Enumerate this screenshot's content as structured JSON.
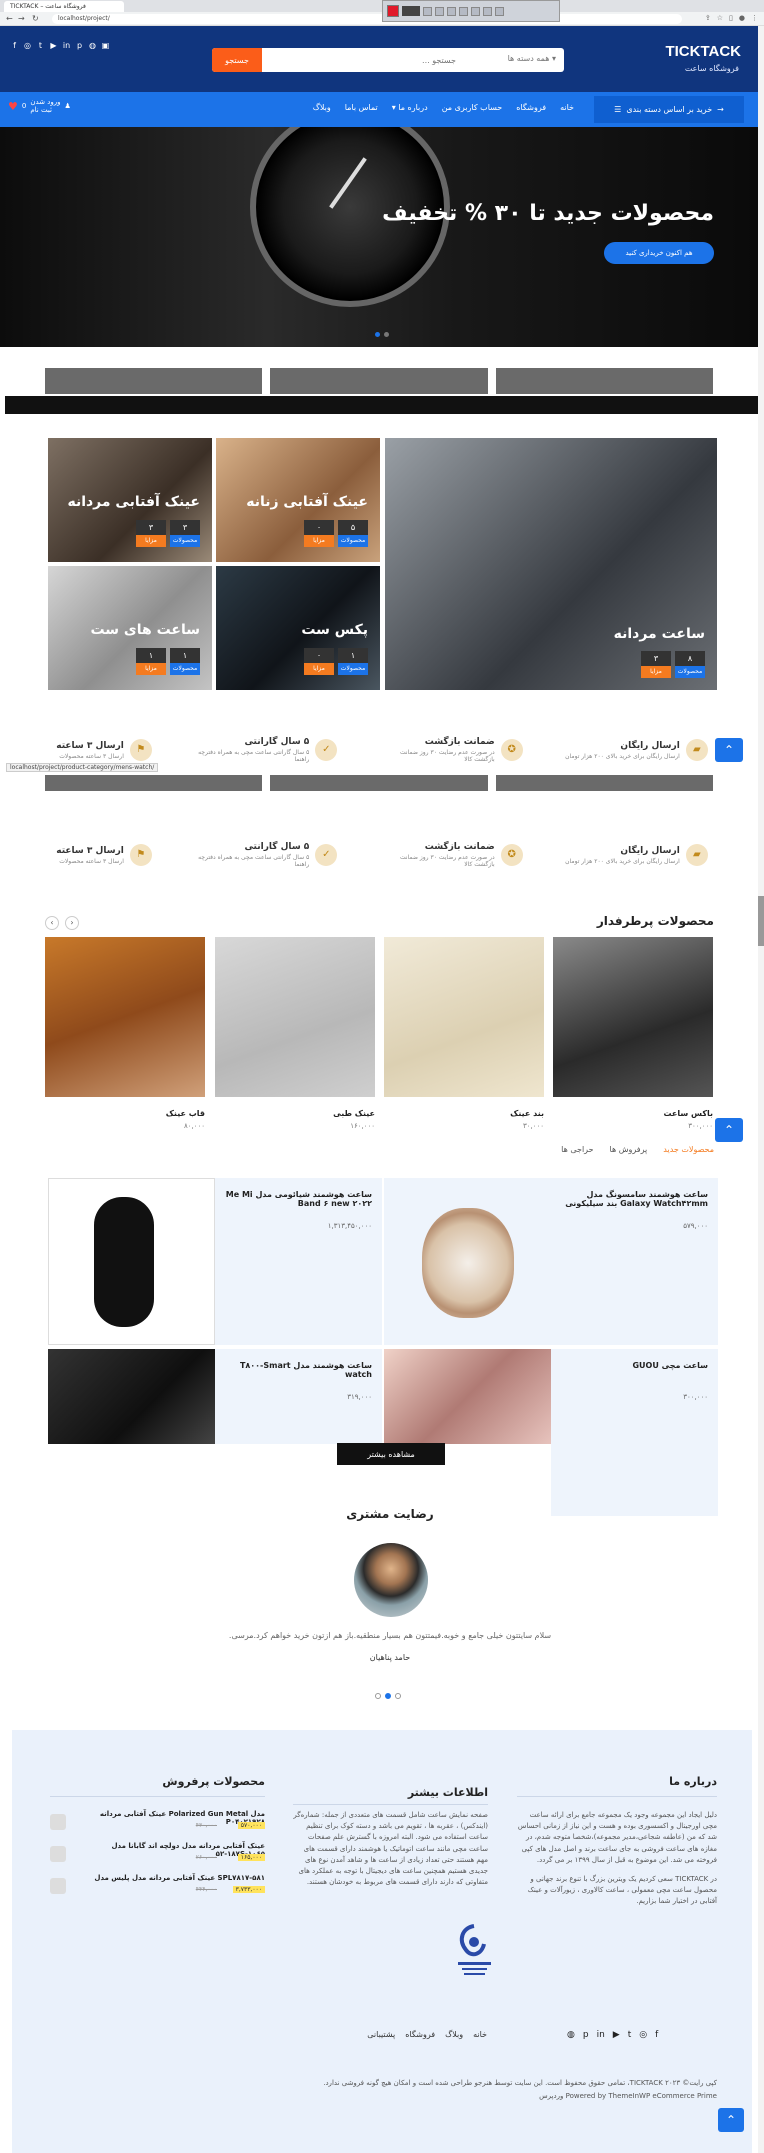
{
  "browser": {
    "tab_title": "TICKTACK – فروشگاه ساعت",
    "address": "localhost/project/"
  },
  "header": {
    "logo_title": "TICKTACK",
    "logo_subtitle": "فروشگاه ساعت",
    "search_button": "جستجو",
    "search_placeholder": "جستجو ...",
    "search_category": "همه دسته ها"
  },
  "nav": {
    "category_button": "خرید بر اساس دسته بندی",
    "links": [
      "خانه",
      "فروشگاه",
      "حساب کاربری من",
      "درباره ما",
      "تماس باما",
      "وبلاگ"
    ],
    "login": "ورود | ثبت نام",
    "login_line1": "ورود شدن",
    "login_line2": "ثبت نام",
    "cart_count": "0"
  },
  "hero": {
    "title": "محصولات جدید تا ۳۰ % تخفیف",
    "button": "هم اکنون خریداری کنید"
  },
  "categories": [
    {
      "label": "ساعت مردانه",
      "badges": [
        {
          "n": "۸",
          "t": "محصولات"
        },
        {
          "n": "۳",
          "t": "مزایا"
        }
      ]
    },
    {
      "label": "عینک آفتابی زنانه",
      "badges": [
        {
          "n": "۵",
          "t": "محصولات"
        },
        {
          "n": "۰",
          "t": "مزایا"
        }
      ]
    },
    {
      "label": "عینک آفتابی مردانه",
      "badges": [
        {
          "n": "۳",
          "t": "محصولات"
        },
        {
          "n": "۳",
          "t": "مزایا"
        }
      ]
    },
    {
      "label": "پکس ست",
      "badges": [
        {
          "n": "۱",
          "t": "محصولات"
        },
        {
          "n": "۰",
          "t": "مزایا"
        }
      ]
    },
    {
      "label": "ساعت های ست",
      "badges": [
        {
          "n": "۱",
          "t": "محصولات"
        },
        {
          "n": "۱",
          "t": "مزایا"
        }
      ]
    }
  ],
  "features": [
    {
      "title": "ارسال رایگان",
      "sub": "ارسال رایگان برای خرید بالای ۲۰۰ هزار تومان"
    },
    {
      "title": "ضمانت بازگشت",
      "sub": "در صورت عدم رضایت ۳۰ روز ضمانت بازگشت کالا"
    },
    {
      "title": "۵ سال گارانتی",
      "sub": "۵ سال گارانتی ساعت مچی به همراه دفترچه راهنما"
    },
    {
      "title": "ارسال ۳ ساعته",
      "sub": "ارسال ۳ ساعته محصولات"
    }
  ],
  "status_url": "localhost/project/product-category/mens-watch/",
  "best_sellers": {
    "title": "محصولات پرطرفدار",
    "items": [
      {
        "name": "باکس ساعت",
        "price": "۳۰۰,۰۰۰"
      },
      {
        "name": "بند عینک",
        "price": "۳۰,۰۰۰"
      },
      {
        "name": "عینک طبی",
        "price": "۱۶۰,۰۰۰"
      },
      {
        "name": "قاب عینک",
        "price": "۸۰,۰۰۰"
      }
    ]
  },
  "tabs": {
    "items": [
      "محصولات جدید",
      "پرفروش ها",
      "حراجی ها"
    ],
    "products": [
      {
        "name": "ساعت هوشمند سامسونگ مدل Galaxy Watch۴۲mm بند سیلیکونی",
        "price": "۵۷۹,۰۰۰"
      },
      {
        "name": "ساعت هوشمند شیائومی مدل Me Mi Band ۶ new ۲۰۲۲",
        "price": "۱,۳۱۳,۴۵۰,۰۰۰"
      },
      {
        "name": "ساعت مچی GUOU",
        "price": "۳۰۰,۰۰۰"
      },
      {
        "name": "ساعت هوشمند مدل T۸۰۰-Smart watch",
        "price": "۳۱۹,۰۰۰"
      }
    ],
    "more_button": "مشاهده بیشتر"
  },
  "testimonials": {
    "title": "رضایت مشتری",
    "text": "سلام سایتتون خیلی جامع و خوبه.فیمتتون هم بسیار منطقیه.باز هم ازتون خرید خواهم کرد.مرسی.",
    "name": "حامد پناهیان"
  },
  "footer": {
    "about_title": "درباره ما",
    "about_text_1": "دلیل ایجاد این مجموعه وجود یک مجموعه جامع برای ارائه ساعت مچی اورجینال و اکسسوری بوده و هست و این نیاز از زمانی احساس شد که من (عاطفه شجاعی،مدیر مجموعه)،شخصا متوجه شدم، در مغازه های ساعت فروشی به جای ساعت برند و اصل مدل های کپی فروخته می شد. این موضوع به قبل از سال ۱۳۹۹ بر می گردد.",
    "about_text_2": "در TICKTACK سعی کردیم یک ویترین بزرگ با تنوع برند جهانی و محصول ساعت مچی معمولی ، ساعت کالاوری ، زیورآلات و عینک آفتابی در اختیار شما بزاریم.",
    "info_title": "اطلاعات بیشتر",
    "info_text": "صفحه نمایش ساعت شامل قسمت های متعددی از جمله: شماره‌گر (ایندکس) ، عقربه ها ، تقویم می باشد و دسته کوک برای تنظیم ساعت استفاده می شود. البته امروزه با گسترش علم صفحات ساعت مچی مانند ساعت اتوماتیک یا هوشمند دارای قسمت های مهم هستند حتی تعداد زیادی از ساعت ها و شاهد آمدن نوع های جدیدی هستیم همچنین ساعت های دیجیتال با توجه به عملکرد های متفاوتی که دارند دارای قسمت های مربوط به خودشان هستند.",
    "products_title": "محصولات پرفروش",
    "products": [
      {
        "name": "عینک آفتابی مردانه Polarized Gun Metal مدل P۰۴۰۲۱۹۲۸",
        "old": "۴۳۰,۰۰۰",
        "new": "۵۷۰,۰۰۰"
      },
      {
        "name": "عینک آفتابی مردانه مدل دولچه اند گابانا مدل ۱۸۷-۵۲S-۱۰۶۵",
        "old": "۲۶۰,۰۰۰",
        "new": "۱۶۵,۰۰۰"
      },
      {
        "name": "عینک آفتابی مردانه مدل پلیس مدل SPL۷۸۱۷-۵۸۱",
        "old": "۴۴۴,۰۰۰",
        "new": "۳,۷۳۳,۰۰۰"
      }
    ],
    "links": [
      "خانه",
      "وبلاگ",
      "فروشگاه",
      "پشتیبانی"
    ],
    "copyright": "کپی رایت© ۲۰۲۳ TICKTACK، تمامی حقوق محفوظ است. این سایت توسط هنرجو طراحی شده است و امکان هیچ گونه فروشی ندارد.",
    "powered": "Powered by ThemeInWP eCommerce Prime وردپرس"
  },
  "colors": {
    "header": "#10357e",
    "nav": "#1c73e8",
    "accent": "#fb5d19",
    "footer_bg": "#eaf1fb"
  }
}
